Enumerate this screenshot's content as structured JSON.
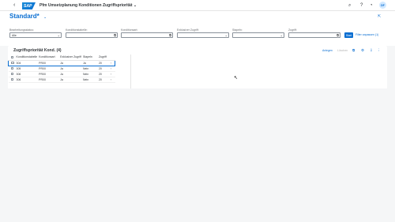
{
  "shell": {
    "back_icon": "chevron-left-icon",
    "logo_text": "SAP",
    "app_title": "Pfm Umsetzplanung Konditionen Zugriffspriorität",
    "app_title_chevron": "⌄",
    "search_icon": "search-icon",
    "bell_icon": "bell-icon",
    "help_icon": "help-icon",
    "avatar_initials": "DF"
  },
  "header": {
    "variant": "Standard",
    "variant_marker": "*",
    "variant_chevron": "⌄"
  },
  "filters": [
    {
      "label": "Bearbeitungsstatus:",
      "value": "Alle",
      "icon": "chevron-down-icon"
    },
    {
      "label": "Konditionstabelle:",
      "value": "",
      "icon": "value-help-icon"
    },
    {
      "label": "Konditionsart:",
      "value": "",
      "icon": "value-help-icon"
    },
    {
      "label": "Exklusiver Zugriff:",
      "value": "",
      "icon": "chevron-down-icon"
    },
    {
      "label": "Stapeln:",
      "value": "",
      "icon": "chevron-down-icon"
    },
    {
      "label": "Zugriff:",
      "value": "",
      "icon": "value-help-icon"
    }
  ],
  "filterbar": {
    "go_label": "Start",
    "adapt_label": "Filter anpassen (1)"
  },
  "table": {
    "title": "Zugriffspriorität Kond. (4)",
    "add_label": "Anlegen",
    "delete_label": "Löschen",
    "columns": [
      "Konditionstabelle",
      "Konditionsart",
      "Exklusiver Zugriff",
      "Stapeln",
      "Zugriff"
    ],
    "rows": [
      [
        "304",
        "PR00",
        "Ja",
        "Ja",
        "20"
      ],
      [
        "305",
        "PR00",
        "Ja",
        "Nein",
        "20"
      ],
      [
        "306",
        "PR00",
        "Ja",
        "Nein",
        "20"
      ],
      [
        "306",
        "PR00",
        "Ja",
        "Nein",
        "20"
      ]
    ],
    "nav_glyph": "›"
  },
  "colors": {
    "accent": "#0a6ed1",
    "shell_bg": "#ffffff",
    "page_bg": "#f5f6f7"
  }
}
